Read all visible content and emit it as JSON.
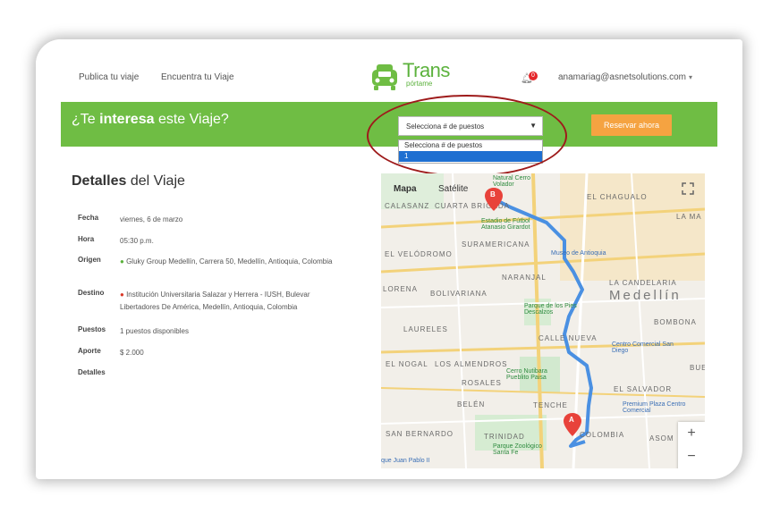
{
  "header": {
    "nav": [
      "Publica tu viaje",
      "Encuentra tu Viaje"
    ],
    "logo_main": "Trans",
    "logo_sub": "pórtame",
    "notification_count": "0",
    "user_email": "anamariag@asnetsolutions.com"
  },
  "banner": {
    "question_prefix": "¿Te ",
    "question_bold": "interesa",
    "question_suffix": " este Viaje?",
    "select_value": "Selecciona # de puestos",
    "reserve_label": "Reservar ahora",
    "dropdown_options": [
      "Selecciona # de puestos",
      "1"
    ]
  },
  "details": {
    "title_bold": "Detalles",
    "title_rest": " del Viaje",
    "rows": [
      {
        "label": "Fecha",
        "value": "viernes, 6 de marzo"
      },
      {
        "label": "Hora",
        "value": "05:30 p.m."
      },
      {
        "label": "Origen",
        "value": "Gluky Group Medellín, Carrera 50, Medellín, Antioquia, Colombia"
      },
      {
        "label": "Destino",
        "value": "Institución Universitaria Salazar y Herrera - IUSH, Bulevar Libertadores De América, Medellín, Antioquia, Colombia"
      },
      {
        "label": "Puestos",
        "value": "1 puestos disponibles"
      },
      {
        "label": "Aporte",
        "value": "$ 2.000"
      },
      {
        "label": "Detalles",
        "value": ""
      }
    ]
  },
  "map": {
    "tabs": [
      "Mapa",
      "Satélite"
    ],
    "labels": [
      "EL CHAGUALO",
      "CALASANZ",
      "CUARTA BRIGADA",
      "LA MA",
      "SURAMERICANA",
      "EL VELÓDROMO",
      "LA CANDELARIA",
      "NARANJAL",
      "Medellín",
      "BOLIVARIANA",
      "LORENA",
      "BOMBONA",
      "LAURELES",
      "CALLE NUEVA",
      "EL NOGAL",
      "LOS ALMENDROS",
      "ROSALES",
      "EL SALVADOR",
      "BELÉN",
      "TENCHE",
      "SAN BERNARDO",
      "TRINIDAD",
      "COLOMBIA",
      "ASOM",
      "BUE"
    ],
    "pois": [
      "Estadio de Fútbol Atanasio Girardot",
      "Museo de Antioquia",
      "Parque de los Pies Descalzos",
      "Centro Comercial San Diego",
      "Cerro Nutibara Pueblito Paisa",
      "Premium Plaza Centro Comercial",
      "Parque Zoológico Santa Fe",
      "Natural Cerro Volador",
      "que Juan Pablo II"
    ],
    "marker_a": "A",
    "marker_b": "B",
    "zoom_in": "+",
    "zoom_out": "−"
  },
  "colors": {
    "green": "#6fbd44",
    "orange": "#f5a341",
    "route": "#4a90e2"
  }
}
